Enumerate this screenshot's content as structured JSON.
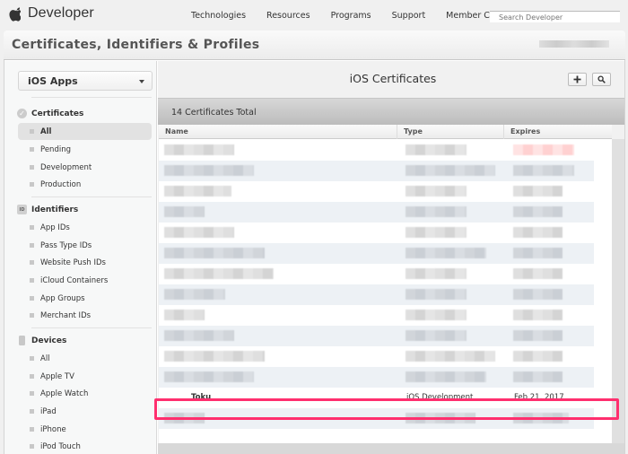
{
  "topbar": {
    "logo_text": "Developer",
    "nav": [
      "Technologies",
      "Resources",
      "Programs",
      "Support",
      "Member Center"
    ],
    "search_placeholder": "Search Developer"
  },
  "header": {
    "title": "Certificates, Identifiers & Profiles"
  },
  "sidebar": {
    "platform": "iOS Apps",
    "sections": [
      {
        "title": "Certificates",
        "icon": "certificate-check-icon",
        "items": [
          {
            "label": "All",
            "active": true
          },
          {
            "label": "Pending"
          },
          {
            "label": "Development"
          },
          {
            "label": "Production"
          }
        ]
      },
      {
        "title": "Identifiers",
        "icon": "id-badge-icon",
        "icon_text": "ID",
        "items": [
          {
            "label": "App IDs"
          },
          {
            "label": "Pass Type IDs"
          },
          {
            "label": "Website Push IDs"
          },
          {
            "label": "iCloud Containers"
          },
          {
            "label": "App Groups"
          },
          {
            "label": "Merchant IDs"
          }
        ]
      },
      {
        "title": "Devices",
        "icon": "device-icon",
        "items": [
          {
            "label": "All"
          },
          {
            "label": "Apple TV"
          },
          {
            "label": "Apple Watch"
          },
          {
            "label": "iPad"
          },
          {
            "label": "iPhone"
          },
          {
            "label": "iPod Touch"
          }
        ]
      }
    ]
  },
  "main": {
    "title": "iOS Certificates",
    "add_icon": "plus-icon",
    "search_icon": "search-icon",
    "total": "14 Certificates Total",
    "columns": [
      "Name",
      "Type",
      "Expires"
    ],
    "highlighted_row": {
      "name_visible": "Toku",
      "type": "iOS Development",
      "expires": "Feb 21, 2017"
    },
    "accent_color": "#ff2f6e"
  }
}
